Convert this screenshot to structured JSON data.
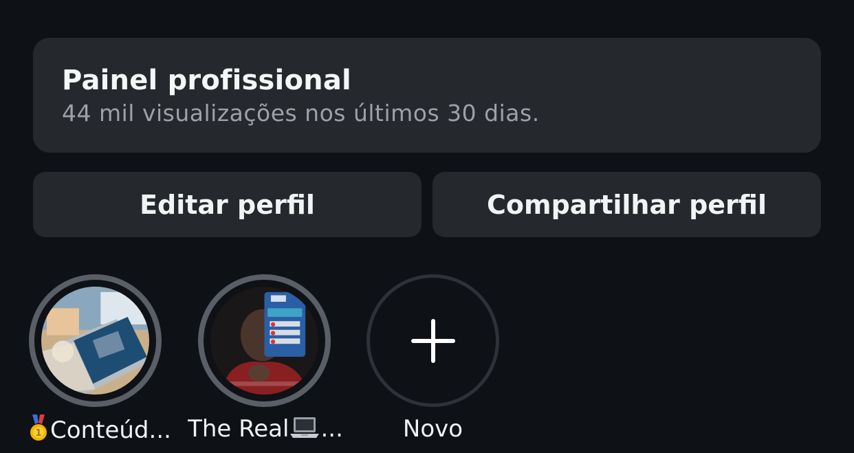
{
  "dashboard": {
    "title": "Painel profissional",
    "subtitle": "44 mil visualizações nos últimos 30 dias."
  },
  "actions": {
    "edit_label": "Editar perfil",
    "share_label": "Compartilhar perfil"
  },
  "highlights": [
    {
      "label": "Conteúd...",
      "emoji": "medal-icon"
    },
    {
      "label": "The Real",
      "suffix": "...",
      "emoji": "laptop-icon"
    },
    {
      "label": "Novo",
      "icon": "plus-icon"
    }
  ],
  "colors": {
    "background": "#0e1115",
    "card": "#25282d",
    "ring": "#5a5e66",
    "subtitle": "#9ea2a8"
  }
}
